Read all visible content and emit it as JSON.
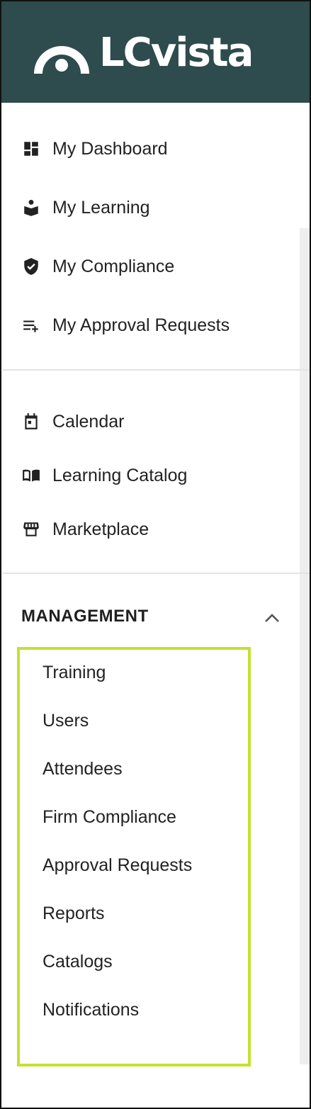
{
  "brand": {
    "name": "LCvista",
    "header_color": "#2e4b4d"
  },
  "nav_primary": [
    {
      "label": "My Dashboard",
      "icon": "dashboard-icon"
    },
    {
      "label": "My Learning",
      "icon": "book-reader-icon"
    },
    {
      "label": "My Compliance",
      "icon": "shield-check-icon"
    },
    {
      "label": "My Approval Requests",
      "icon": "playlist-add-icon"
    }
  ],
  "nav_secondary": [
    {
      "label": "Calendar",
      "icon": "calendar-icon"
    },
    {
      "label": "Learning Catalog",
      "icon": "open-book-icon"
    },
    {
      "label": "Marketplace",
      "icon": "storefront-icon"
    }
  ],
  "management": {
    "title": "MANAGEMENT",
    "highlight_color": "#c5e033",
    "items": [
      "Training",
      "Users",
      "Attendees",
      "Firm Compliance",
      "Approval Requests",
      "Reports",
      "Catalogs",
      "Notifications"
    ]
  }
}
